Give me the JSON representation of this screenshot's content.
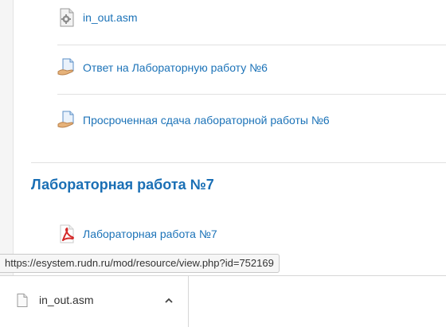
{
  "content": {
    "items": [
      {
        "label": "in_out.asm",
        "icon": "file-gear-icon"
      },
      {
        "label": "Ответ на Лабораторную работу №6",
        "icon": "assignment-icon"
      },
      {
        "label": "Просроченная сдача лабораторной работы №6",
        "icon": "assignment-icon"
      }
    ],
    "section_title": "Лабораторная работа №7",
    "section_items": [
      {
        "label": "Лабораторная работа №7",
        "icon": "pdf-icon"
      }
    ]
  },
  "status_bar": {
    "url": "https://esystem.rudn.ru/mod/resource/view.php?id=752169"
  },
  "downloads": {
    "items": [
      {
        "filename": "in_out.asm",
        "icon": "file-icon",
        "menu_icon": "chevron-up-icon"
      }
    ]
  },
  "colors": {
    "link": "#1c73b8",
    "section_title": "#1a6fb5"
  }
}
